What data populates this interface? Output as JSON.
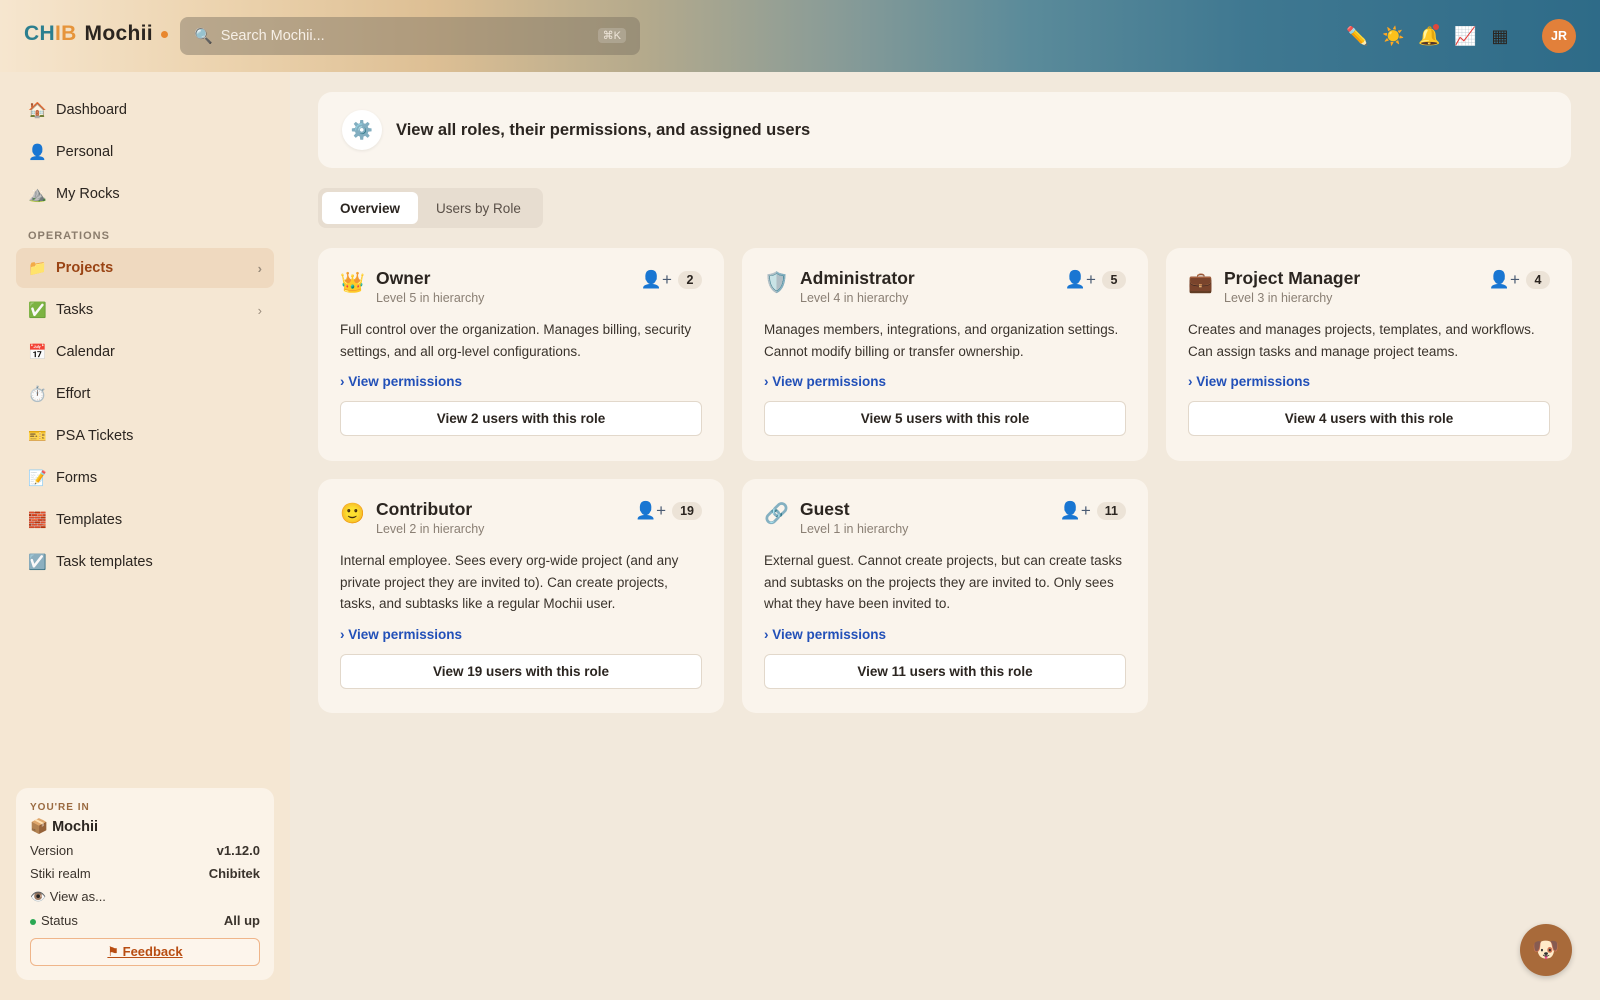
{
  "header": {
    "logo": {
      "part1": "CH",
      "part2": "IB",
      "part3": "Mochii"
    },
    "search_placeholder": "Search Mochii...",
    "search_shortcut": "⌘K",
    "icons": [
      "pencil-icon",
      "sun-icon",
      "bell-icon",
      "chart-icon",
      "grid-icon"
    ],
    "avatar_initials": "JR"
  },
  "sidebar": {
    "items_top": [
      {
        "label": "Dashboard",
        "icon": "🏠"
      },
      {
        "label": "Personal",
        "icon": "👤"
      },
      {
        "label": "My Rocks",
        "icon": "⛰️"
      }
    ],
    "section_label": "OPERATIONS",
    "items_ops": [
      {
        "label": "Projects",
        "icon": "📁",
        "active": true,
        "chevron": "›"
      },
      {
        "label": "Tasks",
        "icon": "✅",
        "chevron": "›"
      },
      {
        "label": "Calendar",
        "icon": "📅"
      },
      {
        "label": "Effort",
        "icon": "⏱️"
      },
      {
        "label": "PSA Tickets",
        "icon": "🎫"
      },
      {
        "label": "Forms",
        "icon": "📝"
      },
      {
        "label": "Templates",
        "icon": "🧱"
      },
      {
        "label": "Task templates",
        "icon": "☑️"
      }
    ],
    "org": {
      "youre_in": "YOU'RE IN",
      "name": "📦 Mochii",
      "version_label": "Version",
      "version": "v1.12.0",
      "realm_label": "Stiki realm",
      "realm": "Chibitek",
      "view_as": "👁️ View as...",
      "status_label": "Status",
      "status": "All up",
      "feedback": "⚑ Feedback"
    }
  },
  "main": {
    "banner_text": "View all roles, their permissions, and assigned users",
    "tabs": [
      "Overview",
      "Users by Role"
    ],
    "roles": [
      {
        "emoji": "👑",
        "name": "Owner",
        "level": "Level 5 in hierarchy",
        "count": "2",
        "desc": "Full control over the organization. Manages billing, security settings, and all org-level configurations.",
        "perm": "› View permissions",
        "button": "View 2 users with this role"
      },
      {
        "emoji": "🛡️",
        "name": "Administrator",
        "level": "Level 4 in hierarchy",
        "count": "5",
        "desc": "Manages members, integrations, and organization settings. Cannot modify billing or transfer ownership.",
        "perm": "› View permissions",
        "button": "View 5 users with this role"
      },
      {
        "emoji": "💼",
        "name": "Project Manager",
        "level": "Level 3 in hierarchy",
        "count": "4",
        "desc": "Creates and manages projects, templates, and workflows. Can assign tasks and manage project teams.",
        "perm": "› View permissions",
        "button": "View 4 users with this role"
      },
      {
        "emoji": "🙂",
        "name": "Contributor",
        "level": "Level 2 in hierarchy",
        "count": "19",
        "desc": "Internal employee. Sees every org-wide project (and any private project they are invited to). Can create projects, tasks, and subtasks like a regular Mochii user.",
        "perm": "› View permissions",
        "button": "View 19 users with this role"
      },
      {
        "emoji": "🔗",
        "name": "Guest",
        "level": "Level 1 in hierarchy",
        "count": "11",
        "desc": "External guest. Cannot create projects, but can create tasks and subtasks on the projects they are invited to. Only sees what they have been invited to.",
        "perm": "› View permissions",
        "button": "View 11 users with this role"
      }
    ]
  },
  "fab_icon": "🐶"
}
